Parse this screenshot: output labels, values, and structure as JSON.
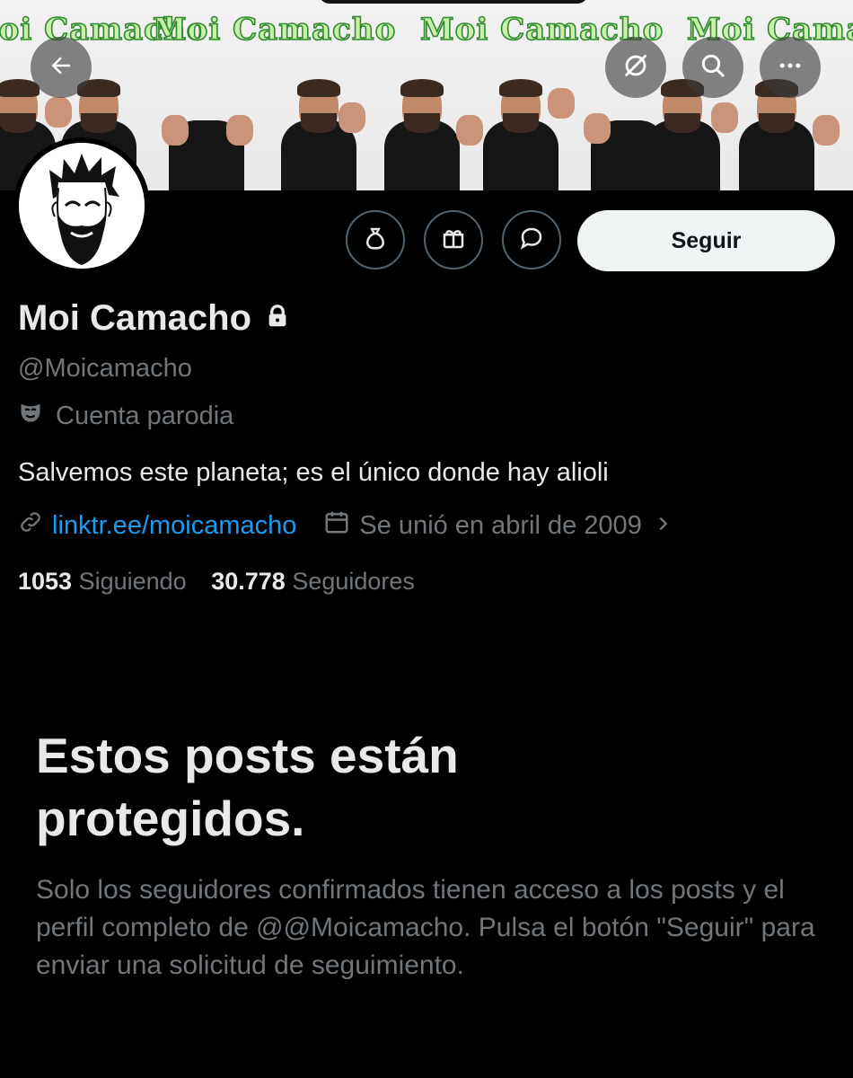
{
  "banner": {
    "repeat_text": "Moi Camacho"
  },
  "header": {
    "back_icon": "arrow-left-icon",
    "hide_icon": "hide-replies-icon",
    "search_icon": "search-icon",
    "more_icon": "more-horizontal-icon"
  },
  "actions": {
    "tip_icon": "money-bag-icon",
    "gift_icon": "gift-icon",
    "message_icon": "message-bubble-icon",
    "follow_label": "Seguir"
  },
  "profile": {
    "name": "Moi Camacho",
    "handle": "@Moicamacho",
    "parody_label": "Cuenta parodia",
    "bio": "Salvemos este planeta; es el único donde hay alioli",
    "link": "linktr.ee/moicamacho",
    "joined": "Se unió en abril de 2009",
    "following_count": "1053",
    "following_label": "Siguiendo",
    "followers_count": "30.778",
    "followers_label": "Seguidores"
  },
  "protected": {
    "title": "Estos posts están protegidos.",
    "body": "Solo los seguidores confirmados tienen acceso a los posts y el perfil completo de @@Moicamacho. Pulsa el botón \"Seguir\" para enviar una solicitud de seguimiento."
  },
  "colors": {
    "background": "#000000",
    "text": "#e7e9ea",
    "secondary": "#71767b",
    "link": "#1d9bf0",
    "follow_button_bg": "#eff3f4"
  }
}
